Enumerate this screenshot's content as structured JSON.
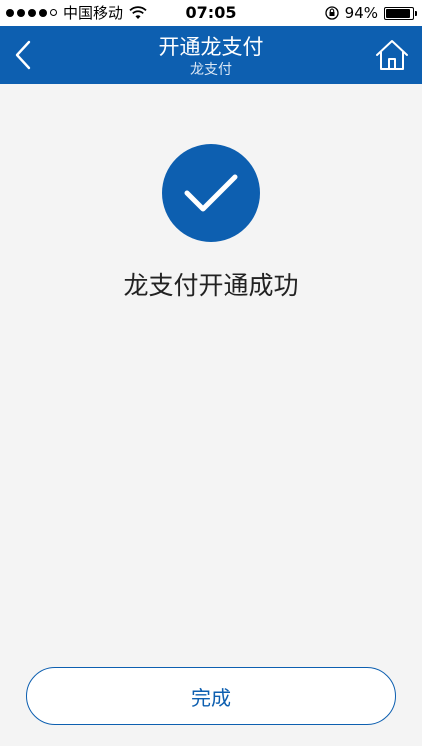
{
  "status_bar": {
    "carrier": "中国移动",
    "time": "07:05",
    "battery": "94%",
    "battery_level": 0.94
  },
  "nav": {
    "title": "开通龙支付",
    "subtitle": "龙支付"
  },
  "result": {
    "message": "龙支付开通成功"
  },
  "actions": {
    "done_label": "完成"
  },
  "colors": {
    "primary": "#0d5fb0",
    "background": "#f4f4f4"
  },
  "icons": {
    "back": "chevron-left-icon",
    "home": "home-icon",
    "success": "checkmark-icon"
  }
}
